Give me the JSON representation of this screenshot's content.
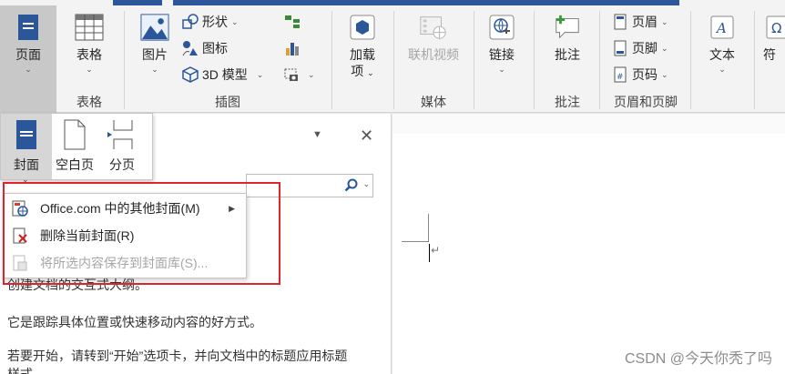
{
  "ribbon": {
    "page_btn": {
      "label": "页面"
    },
    "table_btn": {
      "label": "表格"
    },
    "picture_btn": {
      "label": "图片"
    },
    "shapes": {
      "label": "形状"
    },
    "icons": {
      "label": "图标"
    },
    "models3d": {
      "label": "3D 模型"
    },
    "addins": {
      "label_line1": "加载",
      "label_line2": "项"
    },
    "online_video": {
      "label": "联机视频"
    },
    "link": {
      "label": "链接"
    },
    "comment": {
      "label": "批注"
    },
    "header": {
      "label": "页眉"
    },
    "footer": {
      "label": "页脚"
    },
    "page_number": {
      "label": "页码"
    },
    "text": {
      "label": "文本"
    },
    "symbol": {
      "label": "符"
    },
    "groups": {
      "tables": "表格",
      "illustrations": "插图",
      "media": "媒体",
      "comments": "批注",
      "header_footer": "页眉和页脚"
    }
  },
  "page_dropdown": {
    "cover": "封面",
    "blank": "空白页",
    "break": "分页"
  },
  "cover_menu": {
    "more_covers": "Office.com 中的其他封面(M)",
    "delete_cover": "删除当前封面(R)",
    "save_selection": "将所选内容保存到封面库(S)..."
  },
  "nav_pane": {
    "line1": "创建文档的交互式大纲。",
    "line2": "它是跟踪具体位置或快速移动内容的好方式。",
    "line3": "若要开始，请转到“开始”选项卡，并向文档中的标题应用标题",
    "line4": "样式。"
  },
  "watermark": "CSDN @今天你秃了吗",
  "colors": {
    "accent": "#2b579a",
    "highlight": "#e0242c"
  }
}
